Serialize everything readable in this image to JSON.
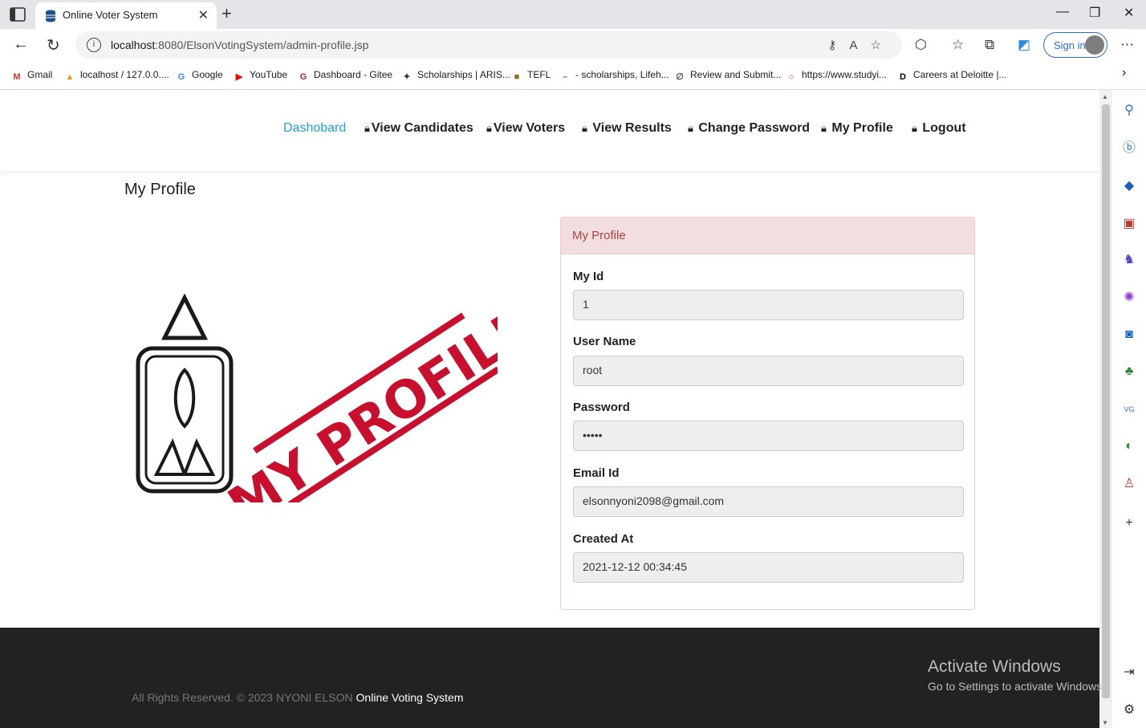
{
  "browser": {
    "tab_title": "Online Voter System",
    "url_host": "localhost",
    "url_path": ":8080/ElsonVotingSystem/admin-profile.jsp",
    "sign_in": "Sign in",
    "bookmarks": [
      {
        "label": "Gmail",
        "icon": "gmail-icon",
        "color": "#d93025",
        "glyph": "M"
      },
      {
        "label": "localhost / 127.0.0....",
        "icon": "phpmyadmin-icon",
        "color": "#f39c12",
        "glyph": "▲"
      },
      {
        "label": "Google",
        "icon": "google-icon",
        "color": "#4285f4",
        "glyph": "G"
      },
      {
        "label": "YouTube",
        "icon": "youtube-icon",
        "color": "#ff0000",
        "glyph": "▶"
      },
      {
        "label": "Dashboard - Gitee",
        "icon": "gitee-icon",
        "color": "#c71d23",
        "glyph": "G"
      },
      {
        "label": "Scholarships | ARIS...",
        "icon": "aris-icon",
        "color": "#333333",
        "glyph": "✦"
      },
      {
        "label": "TEFL",
        "icon": "tefl-icon",
        "color": "#8b6d1f",
        "glyph": "■"
      },
      {
        "label": "- scholarships, Lifeh...",
        "icon": "lifehack-icon",
        "color": "#666666",
        "glyph": "–"
      },
      {
        "label": "Review and Submit...",
        "icon": "review-icon",
        "color": "#555555",
        "glyph": "∅"
      },
      {
        "label": "https://www.studyi...",
        "icon": "studyin-icon",
        "color": "#d93025",
        "glyph": "○"
      },
      {
        "label": "Careers at Deloitte |...",
        "icon": "deloitte-icon",
        "color": "#000000",
        "glyph": "D"
      }
    ]
  },
  "nav": {
    "items": [
      {
        "label": "Dashobard",
        "active": true
      },
      {
        "label": "View Candidates",
        "active": false
      },
      {
        "label": "View Voters",
        "active": false
      },
      {
        "label": "View Results",
        "active": false
      },
      {
        "label": "Change Password",
        "active": false
      },
      {
        "label": "My Profile",
        "active": false
      },
      {
        "label": "Logout",
        "active": false
      }
    ]
  },
  "page": {
    "title": "My Profile",
    "image_text": "MY PROFILE"
  },
  "card": {
    "header": "My Profile",
    "fields": [
      {
        "label": "My Id",
        "value": "1"
      },
      {
        "label": "User Name",
        "value": "root"
      },
      {
        "label": "Password",
        "value": "•••••"
      },
      {
        "label": "Email Id",
        "value": "elsonnyoni2098@gmail.com"
      },
      {
        "label": "Created At",
        "value": "2021-12-12 00:34:45"
      }
    ]
  },
  "footer": {
    "text": "All Rights Reserved. © 2023 NYONI ELSON ",
    "brand": "Online Voting System"
  },
  "watermark": {
    "line1": "Activate Windows",
    "line2": "Go to Settings to activate Windows."
  },
  "colors": {
    "accent": "#21a3d6",
    "card_header_bg": "#f2dede",
    "card_header_text": "#a94442",
    "stamp_red": "#c8102e"
  }
}
